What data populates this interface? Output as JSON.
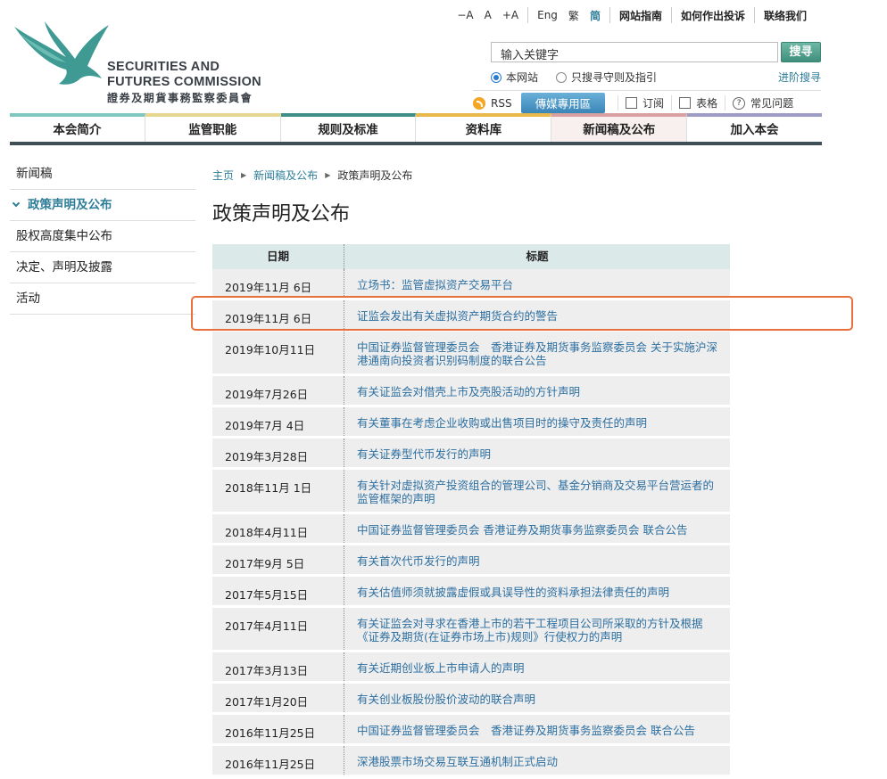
{
  "logo": {
    "name_en_line1": "SECURITIES AND",
    "name_en_line2": "FUTURES COMMISSION",
    "name_zh": "證券及期貨事務監察委員會"
  },
  "toplinks": {
    "font_smaller": "−A",
    "font_normal": "A",
    "font_larger": "+A",
    "lang_en": "Eng",
    "lang_tc": "繁",
    "lang_sc": "简",
    "site_guide": "网站指南",
    "complaint": "如何作出投诉",
    "contact": "联络我们"
  },
  "search": {
    "placeholder": "输入关键字",
    "button": "搜寻",
    "scope_site": "本网站",
    "scope_codes": "只搜寻守则及指引",
    "advanced": "进阶搜寻"
  },
  "utility": {
    "rss": "RSS",
    "media": "傳媒專用區",
    "subscribe": "订阅",
    "forms": "表格",
    "faq": "常见问题"
  },
  "nav": {
    "items": [
      {
        "label": "本会简介",
        "color": "#7fc7c0"
      },
      {
        "label": "监管职能",
        "color": "#e5d790"
      },
      {
        "label": "规则及标准",
        "color": "#3e8f87"
      },
      {
        "label": "资料库",
        "color": "#e8b84a"
      },
      {
        "label": "新闻稿及公布",
        "color": "#d8a0a0"
      },
      {
        "label": "加入本会",
        "color": "#9c9cc4"
      }
    ]
  },
  "side": {
    "items": [
      {
        "label": "新闻稿"
      },
      {
        "label": "政策声明及公布"
      },
      {
        "label": "股权高度集中公布"
      },
      {
        "label": "决定、声明及披露"
      },
      {
        "label": "活动"
      }
    ]
  },
  "breadcrumb": {
    "home": "主页",
    "section": "新闻稿及公布",
    "current": "政策声明及公布"
  },
  "page_title": "政策声明及公布",
  "table": {
    "header_date": "日期",
    "header_title": "标题",
    "rows": [
      {
        "date": "2019年11月 6日",
        "title": "立场书：监管虚拟资产交易平台"
      },
      {
        "date": "2019年11月 6日",
        "title": "证监会发出有关虚拟资产期货合约的警告"
      },
      {
        "date": "2019年10月11日",
        "title": "中国证券监督管理委员会　香港证券及期货事务监察委员会 关于实施沪深港通南向投资者识别码制度的联合公告"
      },
      {
        "date": "2019年7月26日",
        "title": "有关证监会对借壳上市及壳股活动的方针声明"
      },
      {
        "date": "2019年7月 4日",
        "title": "有关董事在考虑企业收购或出售项目时的操守及责任的声明"
      },
      {
        "date": "2019年3月28日",
        "title": "有关证券型代币发行的声明"
      },
      {
        "date": "2018年11月 1日",
        "title": "有关针对虚拟资产投资组合的管理公司、基金分销商及交易平台营运者的监管框架的声明"
      },
      {
        "date": "2018年4月11日",
        "title": "中国证券监督管理委员会 香港证券及期货事务监察委员会 联合公告"
      },
      {
        "date": "2017年9月 5日",
        "title": "有关首次代币发行的声明"
      },
      {
        "date": "2017年5月15日",
        "title": "有关估值师须就披露虚假或具误导性的资料承担法律责任的声明"
      },
      {
        "date": "2017年4月11日",
        "title": "有关证监会对寻求在香港上市的若干工程项目公司所采取的方针及根据《证券及期货(在证券市场上市)规则》行使权力的声明"
      },
      {
        "date": "2017年3月13日",
        "title": "有关近期创业板上市申请人的声明"
      },
      {
        "date": "2017年1月20日",
        "title": "有关创业板股份股价波动的联合声明"
      },
      {
        "date": "2016年11月25日",
        "title": "中国证券监督管理委员会　香港证券及期货事务监察委员会 联合公告"
      },
      {
        "date": "2016年11月25日",
        "title": "深港股票市场交易互联互通机制正式启动"
      }
    ]
  }
}
